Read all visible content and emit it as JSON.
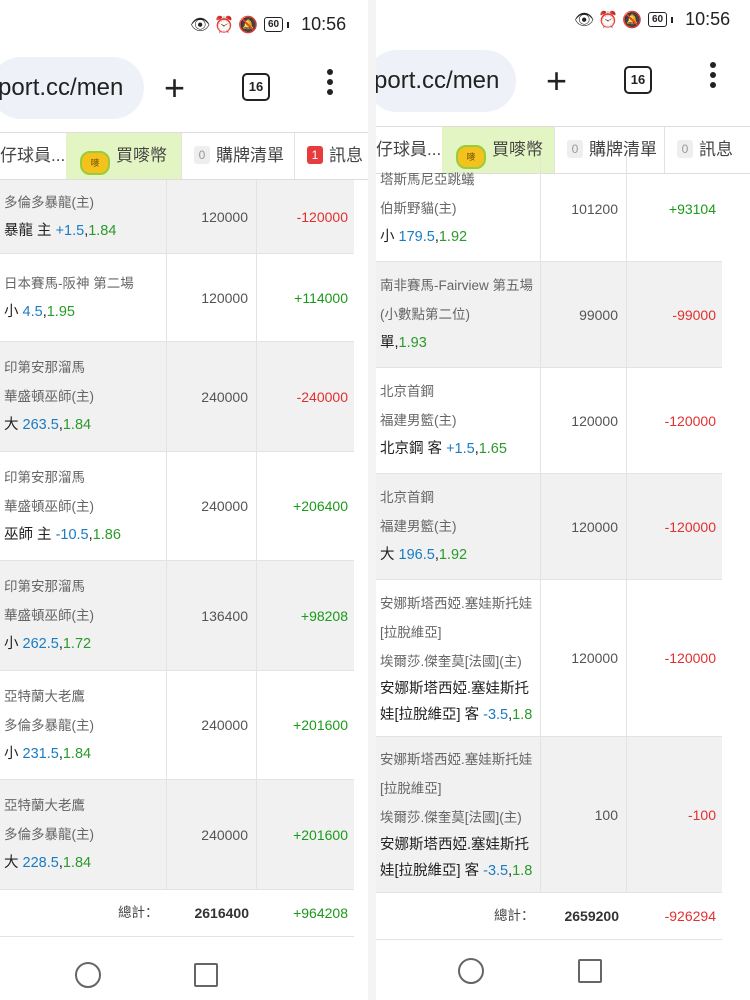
{
  "left": {
    "status": {
      "battery": "60",
      "time": "10:56"
    },
    "url": "port.cc/men",
    "tab_count": "16",
    "tabs": [
      {
        "label": "仔球員...",
        "badge": ""
      },
      {
        "label": "買嘜幣",
        "badge": ""
      },
      {
        "label": "購牌清單",
        "badge": "0"
      },
      {
        "label": "訊息",
        "badge": "1"
      }
    ],
    "rows": [
      {
        "lines": [
          "多倫多暴龍(主)"
        ],
        "sel": "暴龍 主",
        "hc": "+1.5",
        "odds": "1.84",
        "stake": "120000",
        "result": "-120000"
      },
      {
        "lines": [
          "日本賽馬-阪神 第二場"
        ],
        "sel": "小",
        "hc": "4.5",
        "odds": "1.95",
        "stake": "120000",
        "result": "+114000"
      },
      {
        "lines": [
          "印第安那溜馬",
          "華盛頓巫師(主)"
        ],
        "sel": "大",
        "hc": "263.5",
        "odds": "1.84",
        "stake": "240000",
        "result": "-240000"
      },
      {
        "lines": [
          "印第安那溜馬",
          "華盛頓巫師(主)"
        ],
        "sel": "巫師 主",
        "hc": "-10.5",
        "odds": "1.86",
        "stake": "240000",
        "result": "+206400"
      },
      {
        "lines": [
          "印第安那溜馬",
          "華盛頓巫師(主)"
        ],
        "sel": "小",
        "hc": "262.5",
        "odds": "1.72",
        "stake": "136400",
        "result": "+98208"
      },
      {
        "lines": [
          "亞特蘭大老鷹",
          "多倫多暴龍(主)"
        ],
        "sel": "小",
        "hc": "231.5",
        "odds": "1.84",
        "stake": "240000",
        "result": "+201600"
      },
      {
        "lines": [
          "亞特蘭大老鷹",
          "多倫多暴龍(主)"
        ],
        "sel": "大",
        "hc": "228.5",
        "odds": "1.84",
        "stake": "240000",
        "result": "+201600"
      }
    ],
    "total": {
      "label": "總計：",
      "stake": "2616400",
      "result": "+964208"
    }
  },
  "right": {
    "status": {
      "battery": "60",
      "time": "10:56"
    },
    "url": "port.cc/men",
    "tab_count": "16",
    "tabs": [
      {
        "label": "仔球員...",
        "badge": ""
      },
      {
        "label": "買嘜幣",
        "badge": ""
      },
      {
        "label": "購牌清單",
        "badge": "0"
      },
      {
        "label": "訊息",
        "badge": "0"
      }
    ],
    "rows": [
      {
        "lines": [
          "塔斯馬尼亞跳蟻",
          "伯斯野貓(主)"
        ],
        "sel": "小",
        "hc": "179.5",
        "odds": "1.92",
        "stake": "101200",
        "result": "+93104"
      },
      {
        "lines": [
          "南非賽馬-Fairview 第五場",
          "(小數點第二位)"
        ],
        "sel": "單",
        "hc": "",
        "odds": "1.93",
        "stake": "99000",
        "result": "-99000"
      },
      {
        "lines": [
          "北京首鋼",
          "福建男籃(主)"
        ],
        "sel": "北京鋼 客",
        "hc": "+1.5",
        "odds": "1.65",
        "stake": "120000",
        "result": "-120000"
      },
      {
        "lines": [
          "北京首鋼",
          "福建男籃(主)"
        ],
        "sel": "大",
        "hc": "196.5",
        "odds": "1.92",
        "stake": "120000",
        "result": "-120000"
      },
      {
        "lines": [
          "安娜斯塔西婭.塞娃斯托娃",
          "[拉脫維亞]",
          "埃爾莎.傑奎莫[法國](主)"
        ],
        "sel_lines": [
          "安娜斯塔西婭.塞娃斯托",
          "娃[拉脫維亞] 客"
        ],
        "hc": "-3.5",
        "odds": "1.8",
        "stake": "120000",
        "result": "-120000"
      },
      {
        "lines": [
          "安娜斯塔西婭.塞娃斯托娃",
          "[拉脫維亞]",
          "埃爾莎.傑奎莫[法國](主)"
        ],
        "sel_lines": [
          "安娜斯塔西婭.塞娃斯托",
          "娃[拉脫維亞] 客"
        ],
        "hc": "-3.5",
        "odds": "1.8",
        "stake": "100",
        "result": "-100"
      }
    ],
    "total": {
      "label": "總計：",
      "stake": "2659200",
      "result": "-926294"
    }
  }
}
